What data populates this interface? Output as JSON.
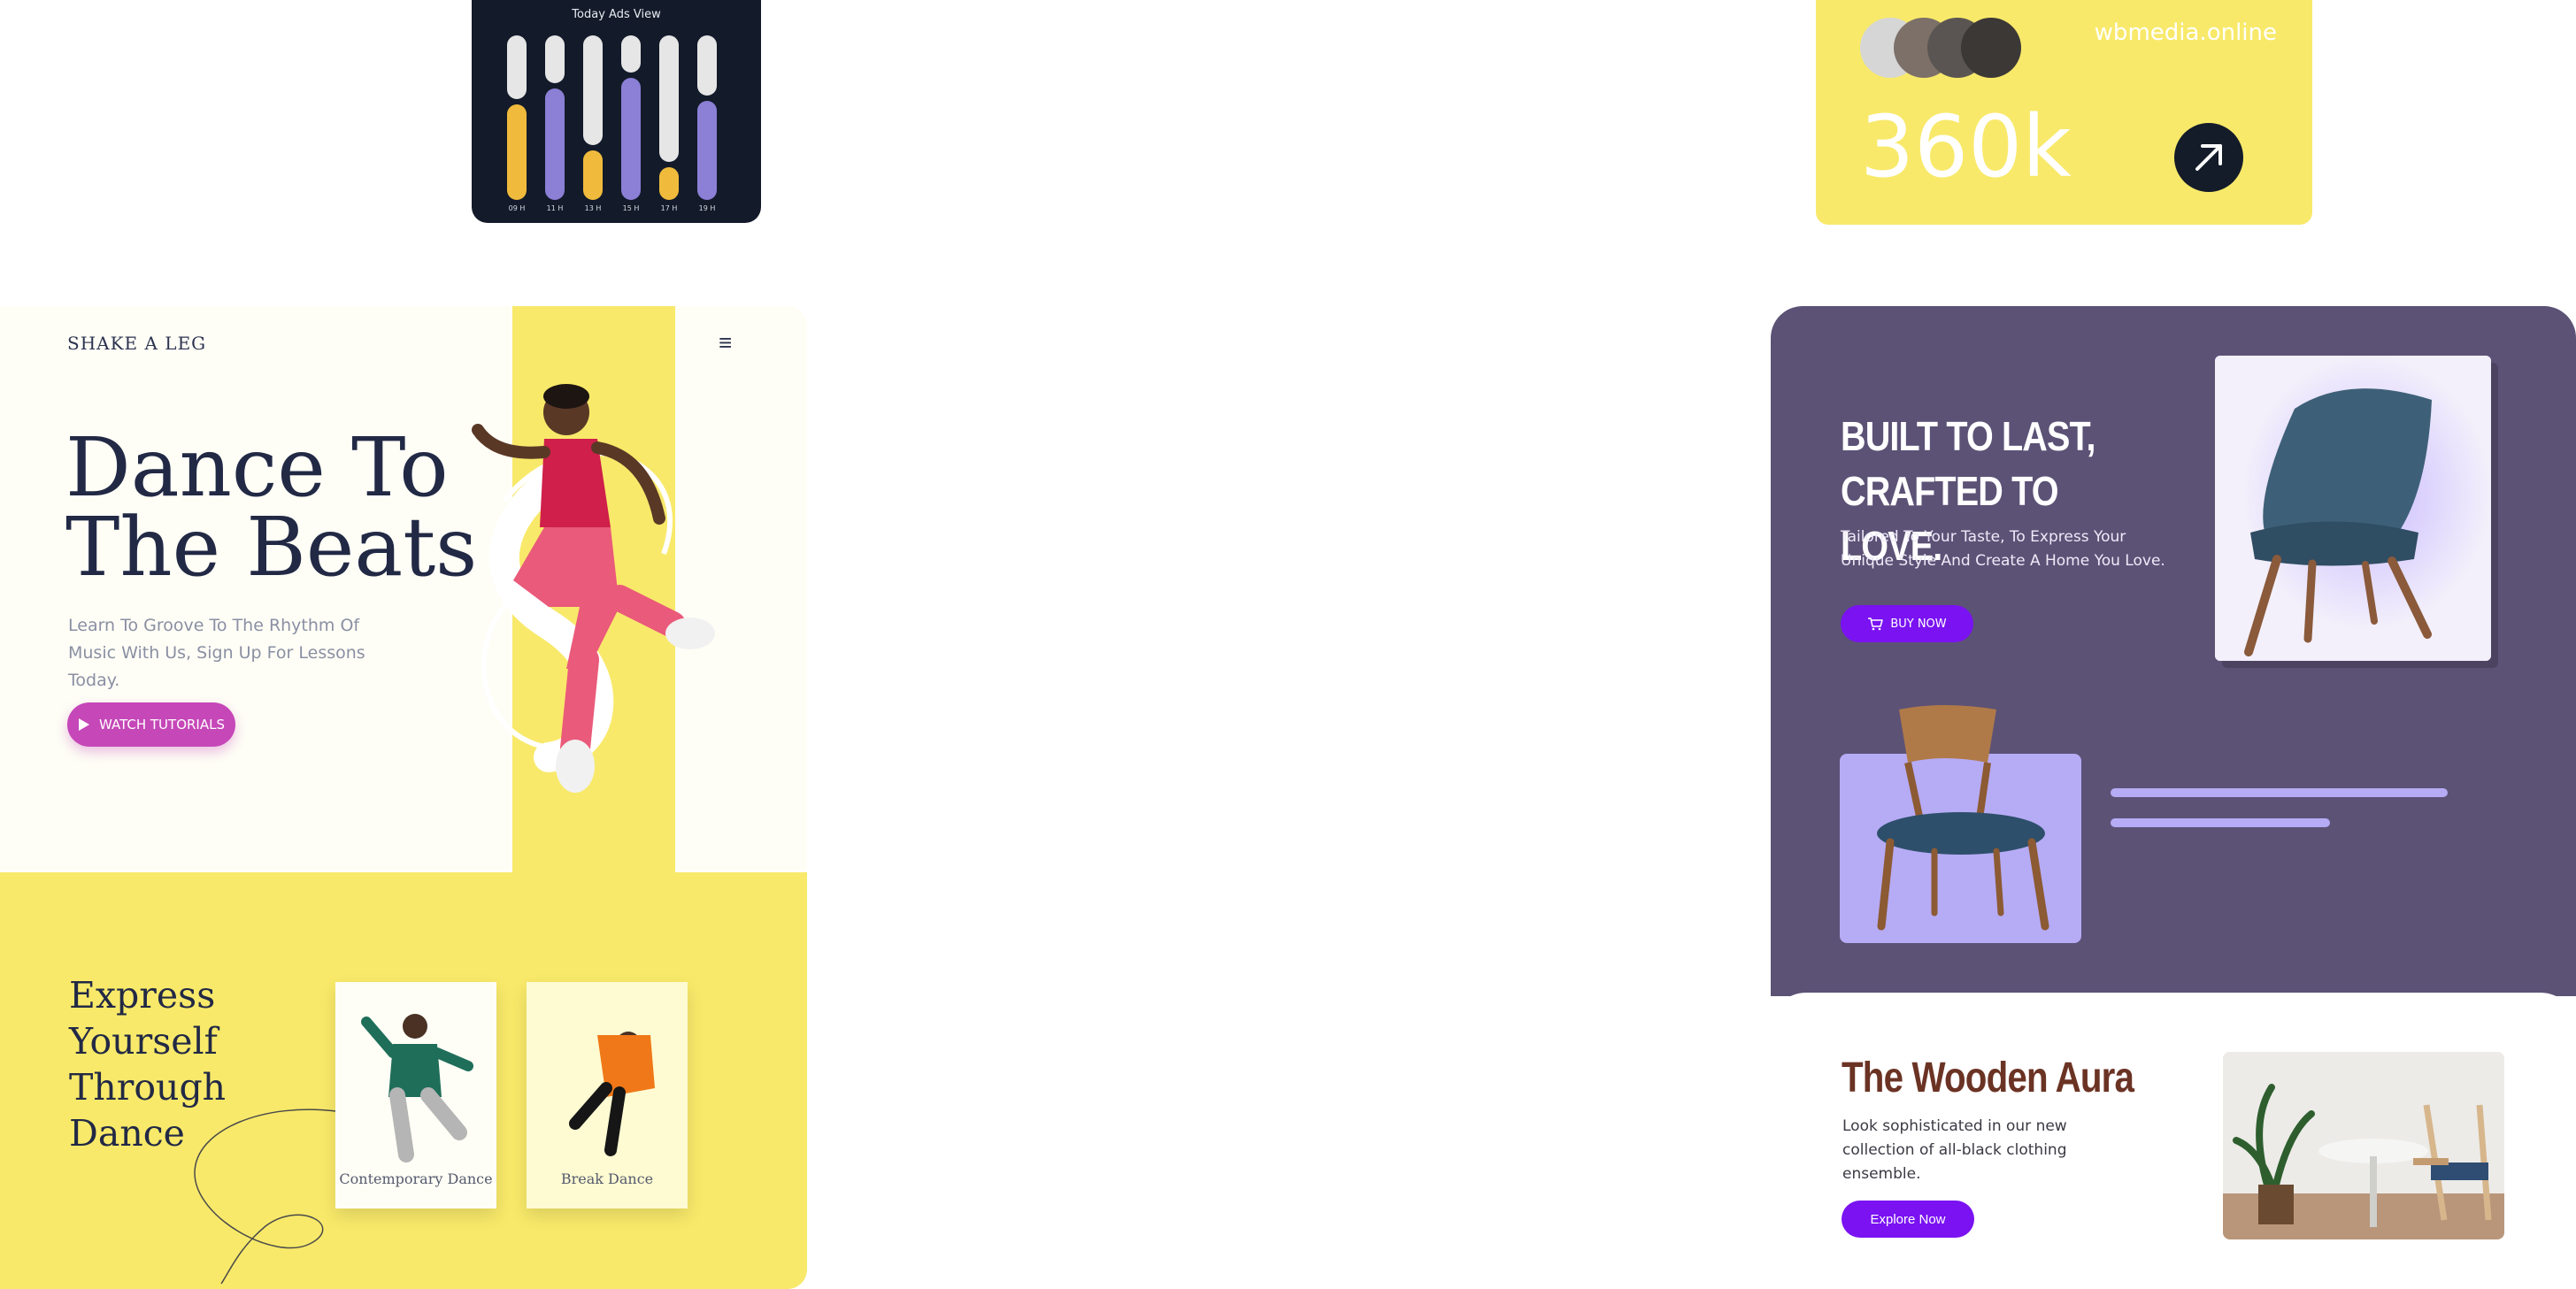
{
  "ads_widget": {
    "title": "Today Ads View",
    "columns": [
      {
        "label": "09 H",
        "value": 0.58,
        "color": "#f0bb3c"
      },
      {
        "label": "11 H",
        "value": 0.68,
        "color": "#8b7fd6"
      },
      {
        "label": "13 H",
        "value": 0.3,
        "color": "#f0bb3c"
      },
      {
        "label": "15 H",
        "value": 0.74,
        "color": "#8b7fd6"
      },
      {
        "label": "17 H",
        "value": 0.2,
        "color": "#f0bb3c"
      },
      {
        "label": "19 H",
        "value": 0.6,
        "color": "#8b7fd6"
      }
    ]
  },
  "stats_widget": {
    "domain": "wbmedia.online",
    "value": "360k",
    "avatars": [
      "#d6d6d6",
      "#7c7068",
      "#5a5552",
      "#3c3836"
    ],
    "icon": "arrow-up-right-icon"
  },
  "dance_page": {
    "logo": "SHAKE A LEG",
    "menu_icon": "≡",
    "headline": "Dance To The Beats",
    "subtitle": "Learn To Groove To The Rhythm Of Music With Us, Sign Up For Lessons Today.",
    "cta": "WATCH TUTORIALS",
    "section_title": "Express Yourself Through Dance",
    "cards": [
      "Contemporary Dance",
      "Break Dance"
    ],
    "accent": "#f8e96a",
    "button_color": "#c547b8"
  },
  "furniture_page": {
    "headline": "BUILT TO LAST, CRAFTED TO LOVE.",
    "tagline": "Tailored To Your Taste, To Express Your Unique Style And Create A Home You Love.",
    "cta": "BUY NOW",
    "collection_title": "The Wooden Aura",
    "collection_desc": "Look sophisticated in our new collection of all-black clothing ensemble.",
    "collection_cta": "Explore Now",
    "bg_color": "#5c5276",
    "button_color": "#7a12f2"
  }
}
